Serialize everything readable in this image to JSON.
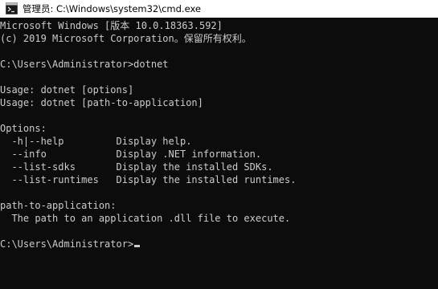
{
  "window": {
    "title": "管理员: C:\\Windows\\system32\\cmd.exe",
    "icon": "cmd-app-icon"
  },
  "console": {
    "lines": [
      "Microsoft Windows [版本 10.0.18363.592]",
      "(c) 2019 Microsoft Corporation。保留所有权利。",
      "C:\\Users\\Administrator>dotnet",
      "Usage: dotnet [options]",
      "Usage: dotnet [path-to-application]",
      "Options:",
      "  -h|--help         Display help.",
      "  --info            Display .NET information.",
      "  --list-sdks       Display the installed SDKs.",
      "  --list-runtimes   Display the installed runtimes.",
      "path-to-application:",
      "  The path to an application .dll file to execute."
    ],
    "prompt": "C:\\Users\\Administrator>"
  }
}
